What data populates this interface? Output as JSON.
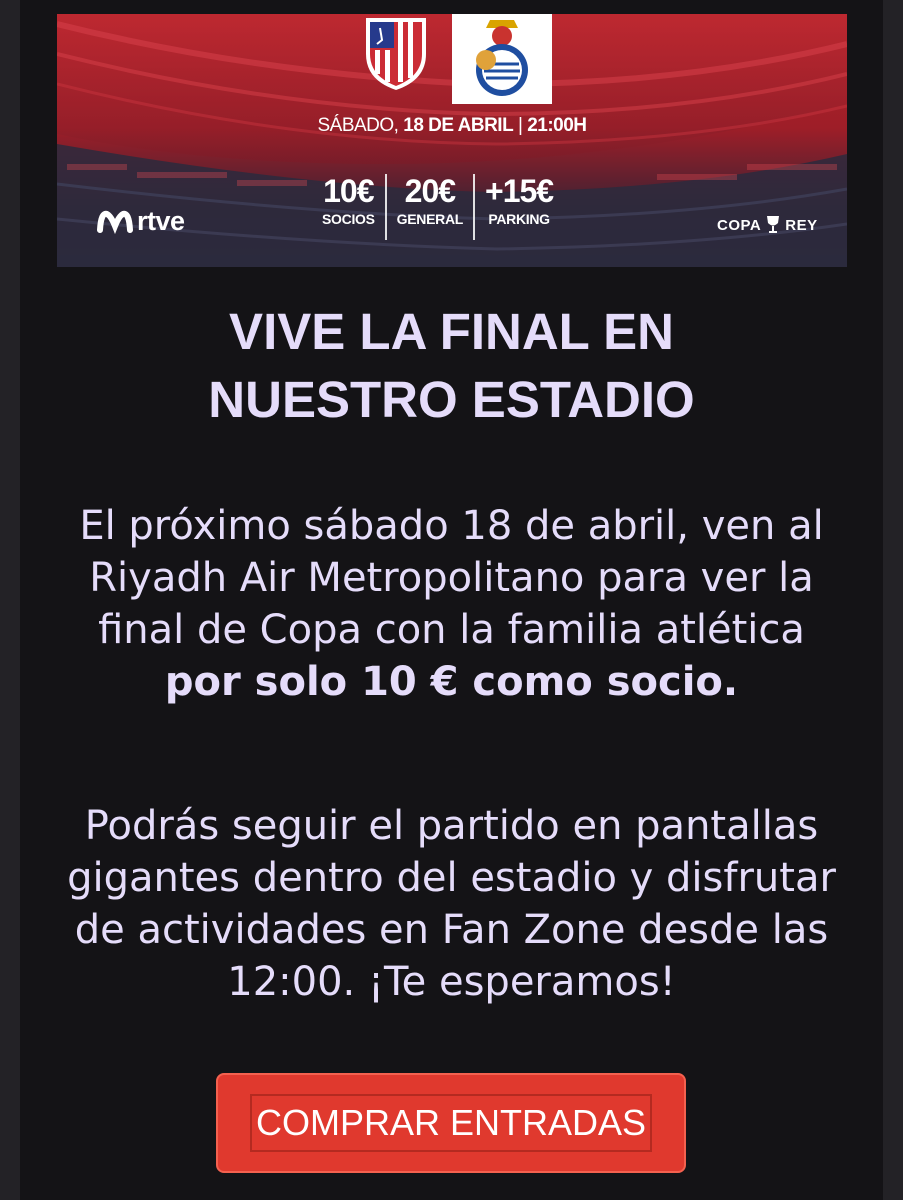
{
  "banner": {
    "date_prefix": "SÁBADO,",
    "date_bold": "18 DE ABRIL",
    "separator": "|",
    "time": "21:00H",
    "prices": [
      {
        "value": "10€",
        "label": "SOCIOS"
      },
      {
        "value": "20€",
        "label": "GENERAL"
      },
      {
        "value": "+15€",
        "label": "PARKING"
      }
    ],
    "sponsor_name": "rtve",
    "cup_left": "COPA",
    "cup_right": "REY",
    "colors": {
      "red": "#b5242c",
      "navy": "#2a2a3e"
    }
  },
  "heading": {
    "line1": "VIVE LA FINAL EN",
    "line2": "NUESTRO ESTADIO"
  },
  "paragraph1": {
    "text": "El próximo sábado 18 de abril, ven al Riyadh Air Metropolitano para ver la final de Copa con la familia atlética ",
    "bold": "por solo 10 € como socio."
  },
  "paragraph2": {
    "text": "Podrás seguir el partido en pantallas gigantes dentro del estadio y disfrutar de actividades en Fan Zone desde las 12:00. ¡Te esperamos!"
  },
  "cta": {
    "label": "COMPRAR ENTRADAS",
    "color": "#e0392e"
  }
}
